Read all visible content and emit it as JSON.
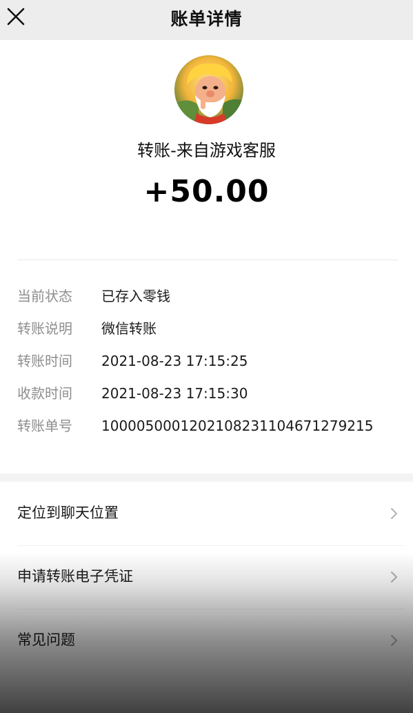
{
  "header": {
    "title": "账单详情"
  },
  "icons": {
    "close": "close-icon",
    "avatar": "game-character-avatar",
    "chevron": "chevron-right-icon"
  },
  "transfer": {
    "payee": "转账-来自游戏客服",
    "amount": "+50.00"
  },
  "details": [
    {
      "label": "当前状态",
      "value": "已存入零钱"
    },
    {
      "label": "转账说明",
      "value": "微信转账"
    },
    {
      "label": "转账时间",
      "value": "2021-08-23 17:15:25"
    },
    {
      "label": "收款时间",
      "value": "2021-08-23 17:15:30"
    },
    {
      "label": "转账单号",
      "value": "1000050001202108231104671279215"
    }
  ],
  "menu": [
    {
      "label": "定位到聊天位置"
    },
    {
      "label": "申请转账电子凭证"
    },
    {
      "label": "常见问题"
    }
  ]
}
